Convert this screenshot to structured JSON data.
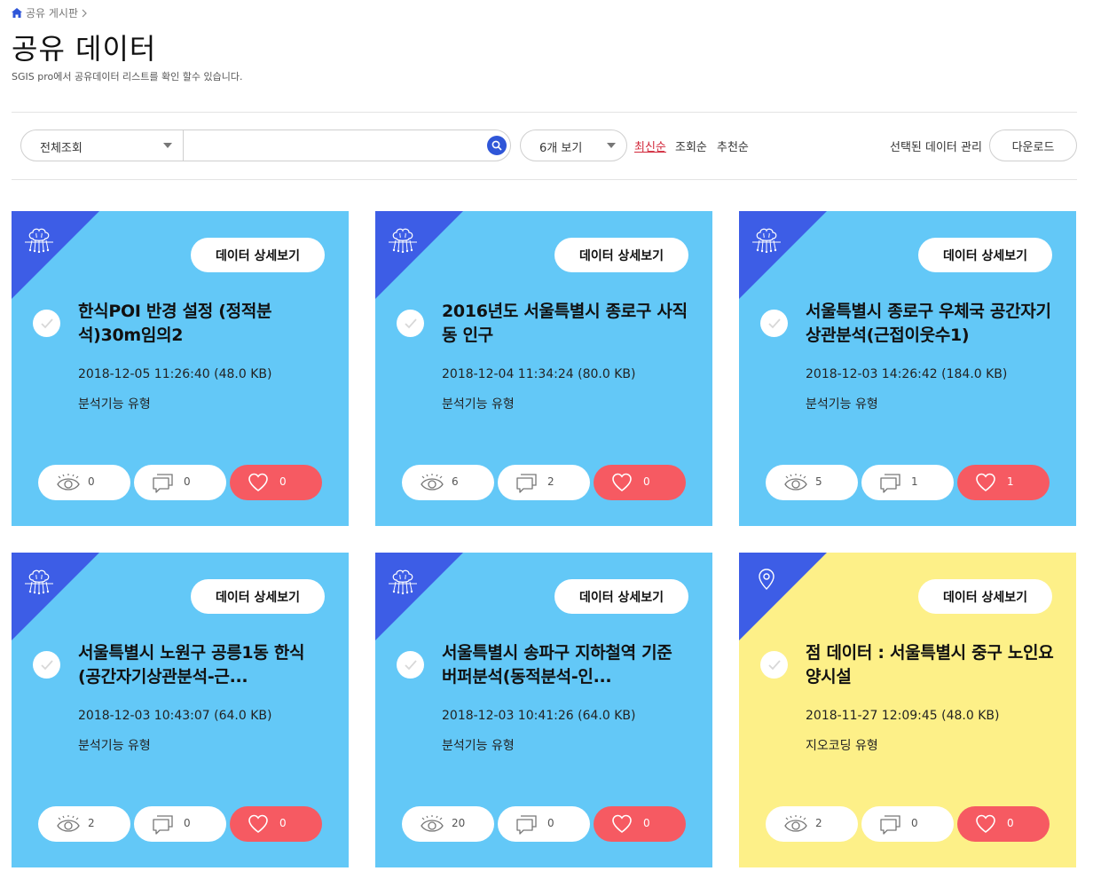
{
  "breadcrumb": {
    "label": "공유 게시판"
  },
  "page": {
    "title": "공유 데이터",
    "description": "SGIS pro에서 공유데이터 리스트를 확인 할수 있습니다."
  },
  "toolbar": {
    "search_scope": "전체조회",
    "search_placeholder": "",
    "page_size": "6개 보기",
    "sort_options": [
      "최신순",
      "조회순",
      "추천순"
    ],
    "active_sort": "최신순",
    "manage_label": "선택된 데이터 관리",
    "download_label": "다운로드"
  },
  "colors": {
    "card_blue": "#63c8f7",
    "card_yellow": "#fdf088",
    "corner": "#3d5de6",
    "like": "#f65a62",
    "active_sort": "#d1283a"
  },
  "cards": [
    {
      "theme": "blue",
      "icon": "brain-circuit-icon",
      "detail_label": "데이터 상세보기",
      "title": "한식POI 반경 설정 (정적분석)30m임의2",
      "date": "2018-12-05 11:26:40 (48.0 KB)",
      "type": "분석기능 유형",
      "views": "0",
      "comments": "0",
      "likes": "0"
    },
    {
      "theme": "blue",
      "icon": "brain-circuit-icon",
      "detail_label": "데이터 상세보기",
      "title": "2016년도 서울특별시 종로구 사직동 인구",
      "date": "2018-12-04 11:34:24 (80.0 KB)",
      "type": "분석기능 유형",
      "views": "6",
      "comments": "2",
      "likes": "0"
    },
    {
      "theme": "blue",
      "icon": "brain-circuit-icon",
      "detail_label": "데이터 상세보기",
      "title": "서울특별시 종로구 우체국 공간자기상관분석(근접이웃수1)",
      "date": "2018-12-03 14:26:42 (184.0 KB)",
      "type": "분석기능 유형",
      "views": "5",
      "comments": "1",
      "likes": "1"
    },
    {
      "theme": "blue",
      "icon": "brain-circuit-icon",
      "detail_label": "데이터 상세보기",
      "title": "서울특별시 노원구 공릉1동 한식(공간자기상관분석-근...",
      "date": "2018-12-03 10:43:07 (64.0 KB)",
      "type": "분석기능 유형",
      "views": "2",
      "comments": "0",
      "likes": "0"
    },
    {
      "theme": "blue",
      "icon": "brain-circuit-icon",
      "detail_label": "데이터 상세보기",
      "title": "서울특별시 송파구 지하철역 기준 버퍼분석(동적분석-인...",
      "date": "2018-12-03 10:41:26 (64.0 KB)",
      "type": "분석기능 유형",
      "views": "20",
      "comments": "0",
      "likes": "0"
    },
    {
      "theme": "yellow",
      "icon": "map-pin-icon",
      "detail_label": "데이터 상세보기",
      "title": "점 데이터 : 서울특별시 중구 노인요양시설",
      "date": "2018-11-27 12:09:45 (48.0 KB)",
      "type": "지오코딩 유형",
      "views": "2",
      "comments": "0",
      "likes": "0"
    }
  ]
}
